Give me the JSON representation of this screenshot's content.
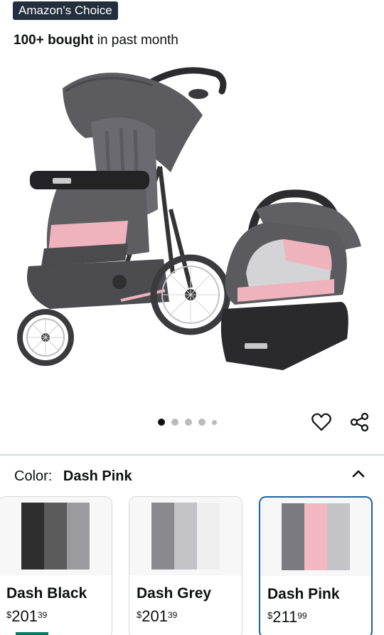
{
  "badge": {
    "label": "Amazon's Choice"
  },
  "purchase_info": {
    "strong": "100+ bought",
    "rest": "in past month"
  },
  "gallery": {
    "image_count": 5,
    "active_index": 0
  },
  "color_selector": {
    "label": "Color:",
    "selected": "Dash Pink",
    "options": [
      {
        "name": "Dash Black",
        "currency": "$",
        "whole": "201",
        "fraction": "39",
        "stripes": [
          "#2e2e2e",
          "#5b5b5b",
          "#9b9b9e"
        ]
      },
      {
        "name": "Dash Grey",
        "currency": "$",
        "whole": "201",
        "fraction": "39",
        "stripes": [
          "#8a8a8e",
          "#c3c2c7",
          "#efefef"
        ]
      },
      {
        "name": "Dash Pink",
        "currency": "$",
        "whole": "211",
        "fraction": "99",
        "stripes": [
          "#7b7a80",
          "#f1b8c2",
          "#c4c3c8"
        ]
      }
    ]
  },
  "icons": {
    "favorite": "heart-icon",
    "share": "share-icon",
    "collapse": "chevron-up-icon"
  }
}
